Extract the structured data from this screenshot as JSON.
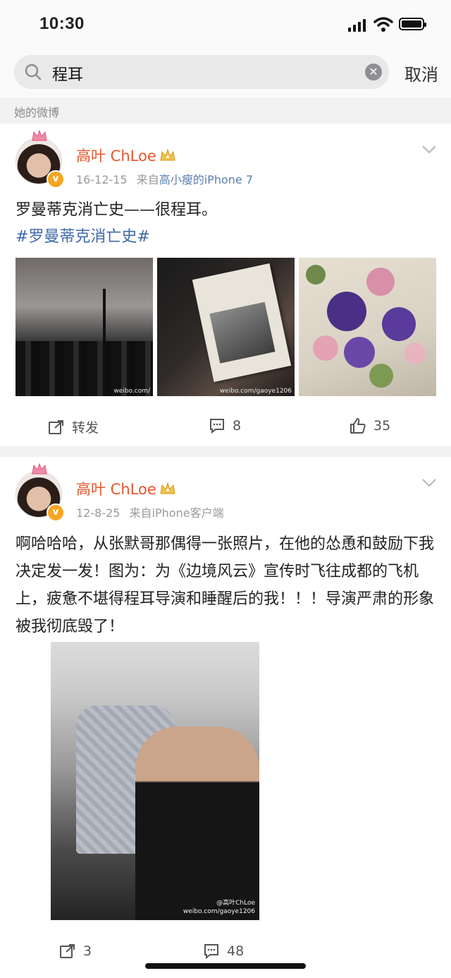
{
  "status_bar": {
    "time": "10:30"
  },
  "search": {
    "query": "程耳",
    "cancel_label": "取消"
  },
  "section_label": "她的微博",
  "posts": [
    {
      "username": "高叶 ChLoe",
      "date": "16-12-15",
      "source_prefix": "来自",
      "source": "高小瘦的iPhone 7",
      "text": "罗曼蒂克消亡史——很程耳。",
      "hashtag": "#罗曼蒂克消亡史#",
      "images": [
        "stage-event-photo",
        "book-photo",
        "flowers-photo"
      ],
      "repost_label": "转发",
      "comments": "8",
      "likes": "35"
    },
    {
      "username": "高叶 ChLoe",
      "date": "12-8-25",
      "source_prefix": "来自",
      "source": "iPhone客户端",
      "text": "啊哈哈哈，从张默哥那偶得一张照片，在他的怂恿和鼓励下我决定发一发！图为：为《边境风云》宣传时飞往成都的飞机上，疲惫不堪得程耳导演和睡醒后的我！！！导演严肃的形象被我彻底毁了！",
      "images": [
        "airplane-photo"
      ],
      "reposts": "3",
      "comments": "48"
    }
  ],
  "colors": {
    "username": "#e8562e",
    "hashtag": "#3e68a8",
    "source": "#5a7fb0",
    "badge": "#f5a623"
  }
}
